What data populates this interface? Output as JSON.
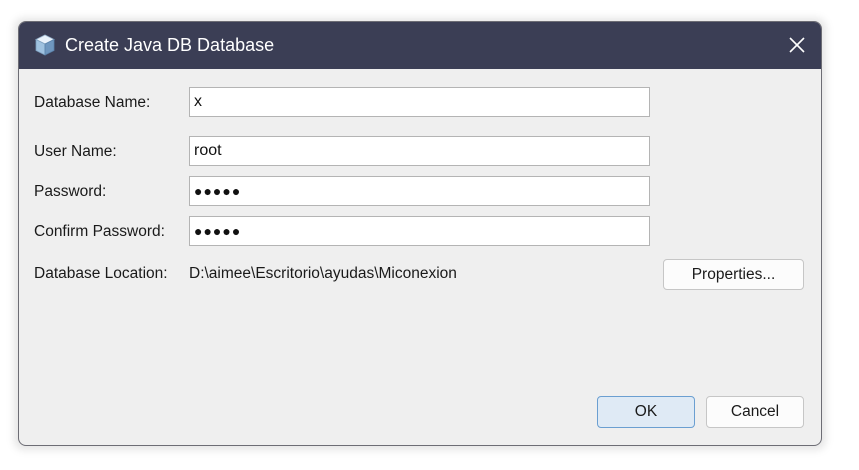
{
  "window": {
    "title": "Create Java DB Database",
    "icon": "javadb-cube-icon",
    "close_icon": "close-icon"
  },
  "form": {
    "database_name": {
      "label": "Database Name:",
      "value": "x"
    },
    "user_name": {
      "label": "User Name:",
      "value": "root"
    },
    "password": {
      "label": "Password:",
      "value": "●●●●●"
    },
    "confirm_password": {
      "label": "Confirm Password:",
      "value": "●●●●●"
    },
    "database_location": {
      "label": "Database Location:",
      "value": "D:\\aimee\\Escritorio\\ayudas\\Miconexion"
    }
  },
  "buttons": {
    "properties": "Properties...",
    "ok": "OK",
    "cancel": "Cancel"
  },
  "colors": {
    "titlebar": "#3b3e55",
    "dialog_bg": "#efefef",
    "default_button_bg": "#dfeaf5",
    "default_button_border": "#6b9fd1"
  }
}
